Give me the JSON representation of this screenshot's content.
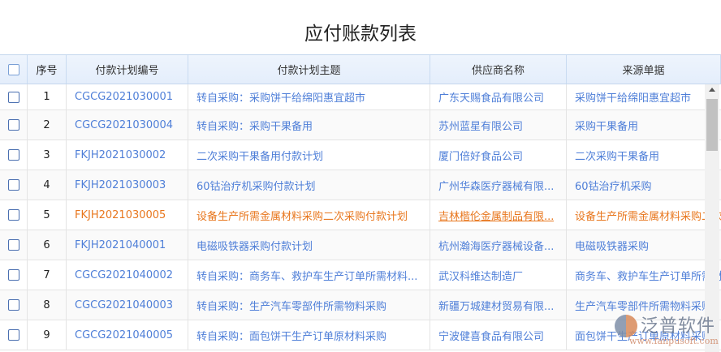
{
  "title": "应付账款列表",
  "columns": [
    "序号",
    "付款计划编号",
    "付款计划主题",
    "供应商名称",
    "来源单据"
  ],
  "rows": [
    {
      "no": "1",
      "code": "CGCG2021030001",
      "subject": "转自采购：采购饼干给绵阳惠宜超市",
      "supplier": "广东天赐食品有限公司",
      "source": "采购饼干给绵阳惠宜超市"
    },
    {
      "no": "2",
      "code": "CGCG2021030004",
      "subject": "转自采购：采购干果备用",
      "supplier": "苏州蓝星有限公司",
      "source": "采购干果备用"
    },
    {
      "no": "3",
      "code": "FKJH2021030002",
      "subject": "二次采购干果备用付款计划",
      "supplier": "厦门倍好食品公司",
      "source": "二次采购干果备用"
    },
    {
      "no": "4",
      "code": "FKJH2021030003",
      "subject": "60钴治疗机采购付款计划",
      "supplier": "广州华森医疗器械有限...",
      "source": "60钴治疗机采购"
    },
    {
      "no": "5",
      "code": "FKJH2021030005",
      "subject": "设备生产所需金属材料采购二次采购付款计划",
      "supplier": "吉林楷伦金属制品有限...",
      "source": "设备生产所需金属材料采购二次采购"
    },
    {
      "no": "6",
      "code": "FKJH2021040001",
      "subject": "电磁吸铁器采购付款计划",
      "supplier": "杭州瀚海医疗器械设备...",
      "source": "电磁吸铁器采购"
    },
    {
      "no": "7",
      "code": "CGCG2021040002",
      "subject": "转自采购：商务车、救护车生产订单所需材料...",
      "supplier": "武汉科维达制造厂",
      "source": "商务车、救护车生产订单所需材料"
    },
    {
      "no": "8",
      "code": "CGCG2021040003",
      "subject": "转自采购：生产汽车零部件所需物料采购",
      "supplier": "新疆万城建材贸易有限...",
      "source": "生产汽车零部件所需物料采购"
    },
    {
      "no": "9",
      "code": "CGCG2021040005",
      "subject": "转自采购：面包饼干生产订单原材料采购",
      "supplier": "宁波健喜食品有限公司",
      "source": "面包饼干生产订单原材料采购"
    }
  ],
  "highlight_row": "5",
  "colors": {
    "link": "#4f7fd8",
    "highlight": "#e8771e"
  },
  "watermark": {
    "name": "泛普软件",
    "url": "www.fanpusoft.com"
  }
}
